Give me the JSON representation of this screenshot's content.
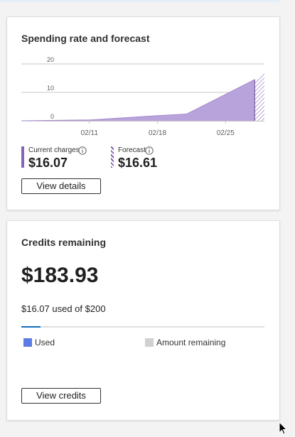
{
  "spending": {
    "title": "Spending rate and forecast",
    "current_label": "Current charges",
    "current_value": "$16.07",
    "forecast_label": "Forecast",
    "forecast_value": "$16.61",
    "details_button": "View details",
    "colors": {
      "current": "#8764b8",
      "forecast": "#8764b8",
      "area_fill": "#b9a3db"
    }
  },
  "chart_data": {
    "type": "area",
    "title": "",
    "xlabel": "",
    "ylabel": "",
    "ylim": [
      0,
      20
    ],
    "yticks": [
      "20",
      "10",
      "0"
    ],
    "xticks": [
      "02/11",
      "02/18",
      "02/25"
    ],
    "series": [
      {
        "name": "Current charges",
        "x": [
          "02/04",
          "02/11",
          "02/18",
          "02/21",
          "02/28"
        ],
        "values": [
          0,
          0.3,
          1.8,
          2.4,
          14.5
        ]
      },
      {
        "name": "Forecast",
        "x": [
          "02/28",
          "03/01"
        ],
        "values": [
          14.5,
          16.61
        ]
      }
    ],
    "grid": true
  },
  "credits": {
    "title": "Credits remaining",
    "amount": "$183.93",
    "used_text": "$16.07 used of $200",
    "used_fraction": 0.08,
    "legend_used": "Used",
    "legend_remaining": "Amount remaining",
    "credits_button": "View credits",
    "colors": {
      "used": "#5b7be6",
      "remaining": "#d2d0ce",
      "progress": "#0f6cbd"
    }
  },
  "icons": {
    "info": "info-icon",
    "cursor": "mouse-pointer-icon"
  }
}
